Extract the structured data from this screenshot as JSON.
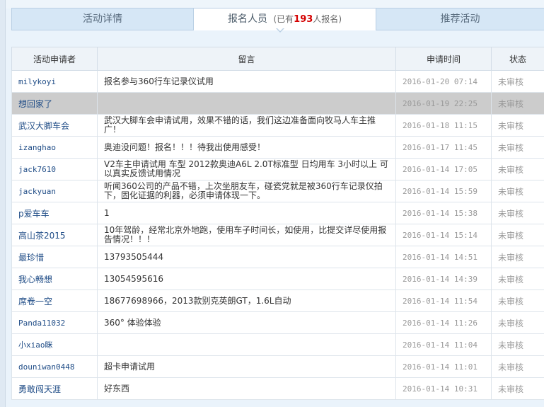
{
  "tabs": {
    "details": "活动详情",
    "members": "报名人员",
    "count_prefix": "已有",
    "count": "193",
    "count_suffix": "人报名",
    "paren_open": "(",
    "paren_close": ")",
    "recommend": "推荐活动"
  },
  "table": {
    "headers": [
      "活动申请者",
      "留言",
      "申请时间",
      "状态"
    ],
    "rows": [
      {
        "user": "milykoyi",
        "message": "报名参与360行车记录仪试用",
        "time": "2016-01-20 07:14",
        "status": "未审核"
      },
      {
        "user": "想回家了",
        "message": "",
        "time": "2016-01-19 22:25",
        "status": "未审核"
      },
      {
        "user": "武汉大脚车会",
        "message": "武汉大脚车会申请试用，效果不错的话，我们这边准备面向牧马人车主推广！",
        "time": "2016-01-18 11:15",
        "status": "未审核"
      },
      {
        "user": "izanghao",
        "message": "奥迪没问题！报名！！！待我出使用感受！",
        "time": "2016-01-17 11:45",
        "status": "未审核"
      },
      {
        "user": "jack7610",
        "message": "V2车主申请试用 车型 2012款奥迪A6L 2.0T标准型 日均用车 3小时以上 可以真实反馈试用情况",
        "time": "2016-01-14 17:05",
        "status": "未审核"
      },
      {
        "user": "jackyuan",
        "message": "听闻360公司的产品不错，上次坐朋友车，碰瓷党就是被360行车记录仪拍下，固化证据的利器，必须申请体现一下。",
        "time": "2016-01-14 15:59",
        "status": "未审核"
      },
      {
        "user": "p爱车车",
        "message": "1",
        "time": "2016-01-14 15:38",
        "status": "未审核"
      },
      {
        "user": "高山茶2015",
        "message": "10年驾龄，经常北京外地跑，使用车子时间长，如使用，比提交详尽使用报告情况！！！",
        "time": "2016-01-14 15:14",
        "status": "未审核"
      },
      {
        "user": "最珍惜",
        "message": "13793505444",
        "time": "2016-01-14 14:51",
        "status": "未审核"
      },
      {
        "user": "我心畅想",
        "message": "13054595616",
        "time": "2016-01-14 14:39",
        "status": "未审核"
      },
      {
        "user": "席卷一空",
        "message": "18677698966，2013款别克英朗GT，1.6L自动",
        "time": "2016-01-14 11:54",
        "status": "未审核"
      },
      {
        "user": "Panda11032",
        "message": "360° 体验体验",
        "time": "2016-01-14 11:26",
        "status": "未审核"
      },
      {
        "user": "小xiao眯",
        "message": "",
        "time": "2016-01-14 11:04",
        "status": "未审核"
      },
      {
        "user": "douniwan0448",
        "message": "超卡申请试用",
        "time": "2016-01-14 11:01",
        "status": "未审核"
      },
      {
        "user": "勇敢闯天涯",
        "message": "好东西",
        "time": "2016-01-14 10:31",
        "status": "未审核"
      }
    ]
  }
}
